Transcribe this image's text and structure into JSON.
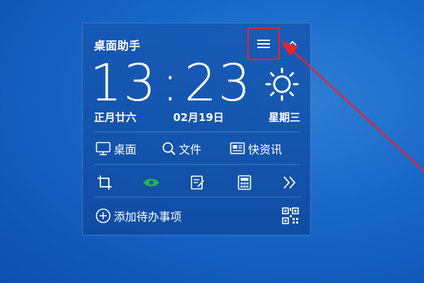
{
  "widget": {
    "title": "桌面助手",
    "time": {
      "hours": "13",
      "colon": ":",
      "minutes": "23"
    },
    "date": {
      "lunar": "正月廿六",
      "solar": "02月19日",
      "weekday": "星期三"
    },
    "nav": [
      {
        "label": "桌面",
        "icon": "monitor-icon"
      },
      {
        "label": "文件",
        "icon": "search-icon"
      },
      {
        "label": "快资讯",
        "icon": "news-icon"
      }
    ],
    "tools": [
      {
        "icon": "crop-icon"
      },
      {
        "icon": "eye-icon"
      },
      {
        "icon": "edit-icon"
      },
      {
        "icon": "calculator-icon"
      },
      {
        "icon": "double-chevron-right-icon"
      }
    ],
    "todo": {
      "label": "添加待办事项",
      "icon": "plus-circle-icon"
    },
    "qr_icon": "qrcode-icon",
    "menu_icon": "hamburger-icon",
    "collapse_icon": "chevron-up-icon",
    "weather_icon": "sun-icon"
  },
  "colors": {
    "annotation": "#e8232b",
    "eye_accent": "#26b64a",
    "widget_bg": "#1658b2",
    "desktop_bg": "#1766c7"
  }
}
